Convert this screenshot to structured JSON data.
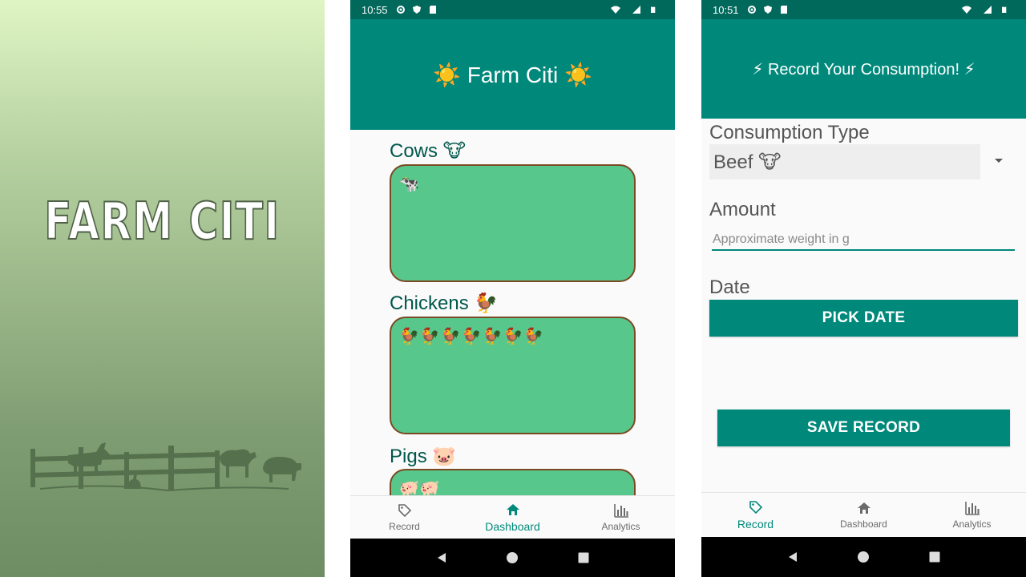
{
  "splash": {
    "title": "FARM CITI"
  },
  "dashboard": {
    "status_time": "10:55",
    "app_title": "☀️ Farm Citi ☀️",
    "sections": [
      {
        "title": "Cows 🐮",
        "contents": "🐄"
      },
      {
        "title": "Chickens 🐓",
        "contents": "🐓🐓🐓🐓🐓🐓🐓"
      },
      {
        "title": "Pigs 🐷",
        "contents": "🐖🐖"
      }
    ],
    "nav": [
      {
        "label": "Record",
        "icon": "tag-icon",
        "active": false
      },
      {
        "label": "Dashboard",
        "icon": "home-icon",
        "active": true
      },
      {
        "label": "Analytics",
        "icon": "bar-chart-icon",
        "active": false
      }
    ]
  },
  "record": {
    "status_time": "10:51",
    "app_title": "⚡ Record Your Consumption! ⚡",
    "consumption_type_label": "Consumption Type",
    "consumption_type_value": "Beef 🐮",
    "amount_label": "Amount",
    "amount_placeholder": "Approximate weight in g",
    "amount_value": "",
    "date_label": "Date",
    "pick_date_button": "PICK DATE",
    "save_button": "SAVE RECORD",
    "nav": [
      {
        "label": "Record",
        "icon": "tag-icon",
        "active": true
      },
      {
        "label": "Dashboard",
        "icon": "home-icon",
        "active": false
      },
      {
        "label": "Analytics",
        "icon": "bar-chart-icon",
        "active": false
      }
    ]
  },
  "colors": {
    "primary": "#00897b",
    "primary_dark": "#00695c",
    "pen_fill": "#58c78b",
    "pen_border": "#7a4a24",
    "section_title": "#00574b"
  }
}
